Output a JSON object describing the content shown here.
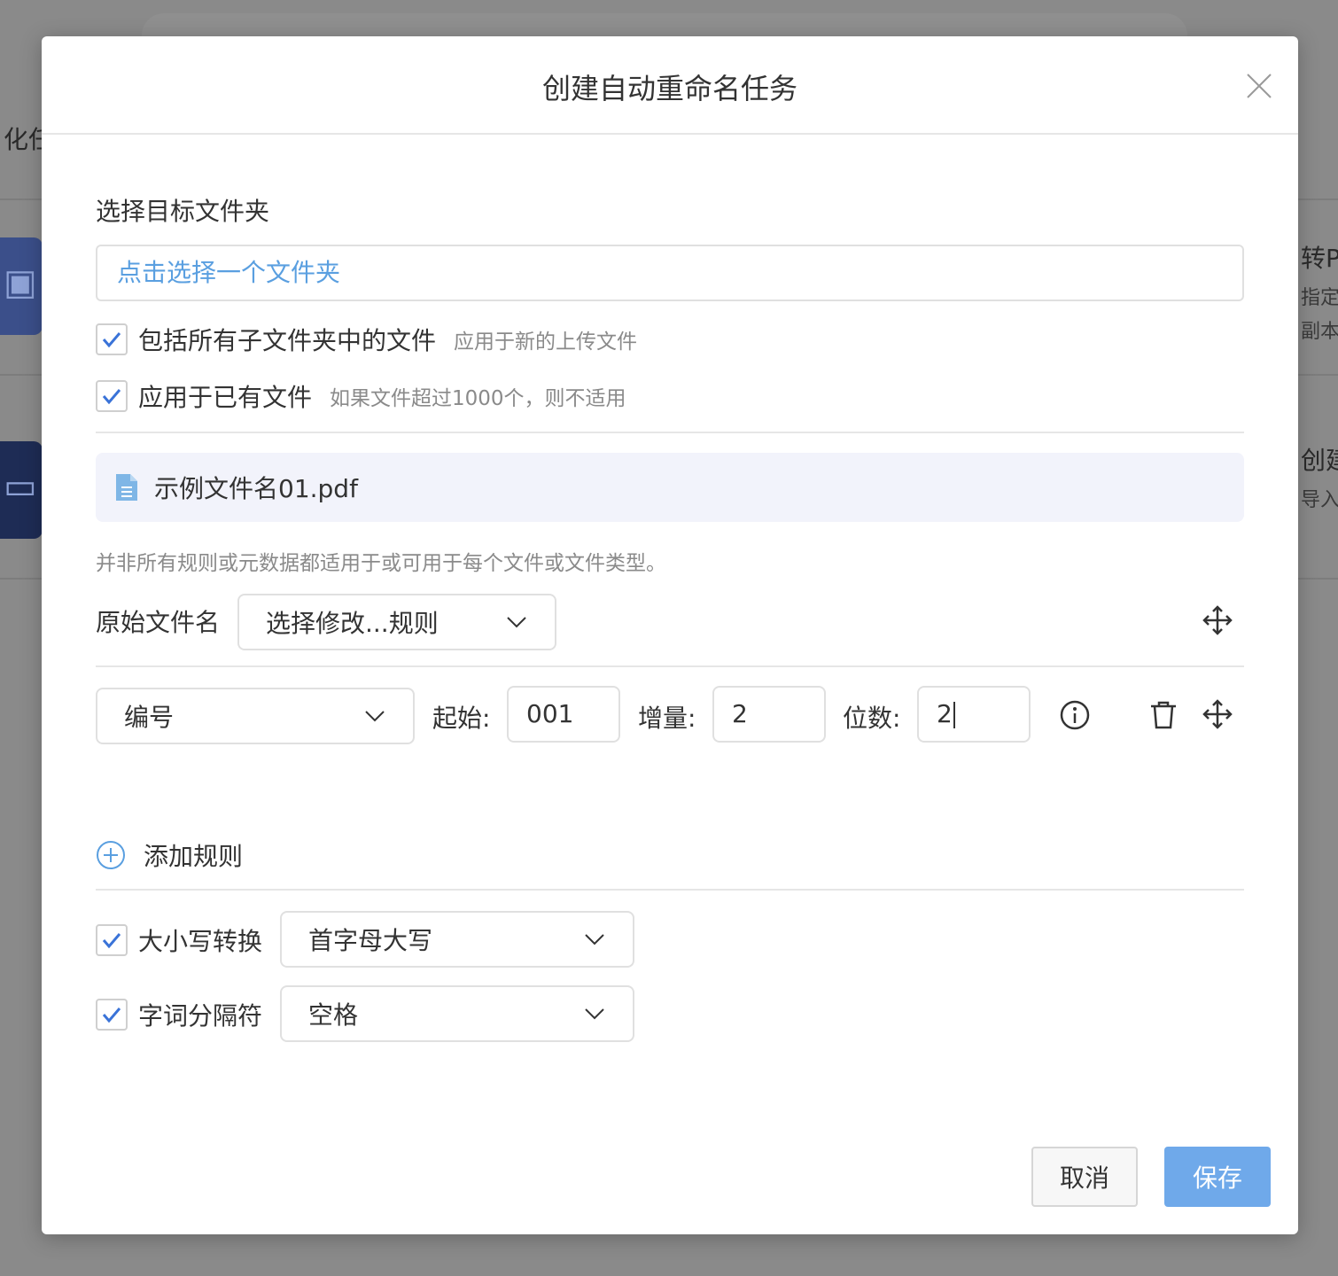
{
  "background": {
    "fragments": [
      "化任",
      "转PD",
      "指定文",
      "副本。",
      "创建",
      "导入e"
    ]
  },
  "modal": {
    "title": "创建自动重命名任务",
    "close_icon": "close-icon"
  },
  "target_folder": {
    "label": "选择目标文件夹",
    "placeholder": "点击选择一个文件夹"
  },
  "options": [
    {
      "label": "包括所有子文件夹中的文件",
      "hint": "应用于新的上传文件",
      "checked": true
    },
    {
      "label": "应用于已有文件",
      "hint": "如果文件超过1000个，则不适用",
      "checked": true
    }
  ],
  "preview": {
    "icon": "document-icon",
    "filename": "示例文件名01.pdf"
  },
  "note": "并非所有规则或元数据都适用于或可用于每个文件或文件类型。",
  "rule_original": {
    "label": "原始文件名",
    "select_value": "选择修改...规则"
  },
  "rule_number": {
    "type_value": "编号",
    "start_label": "起始:",
    "start_value": "001",
    "increment_label": "增量:",
    "increment_value": "2",
    "digits_label": "位数:",
    "digits_value": "2"
  },
  "add_rule_label": "添加规则",
  "case_convert": {
    "label": "大小写转换",
    "value": "首字母大写",
    "checked": true
  },
  "word_separator": {
    "label": "字词分隔符",
    "value": "空格",
    "checked": true
  },
  "footer": {
    "cancel_label": "取消",
    "save_label": "保存"
  },
  "colors": {
    "accent": "#5a9fe0",
    "save_button": "#6fa9ea",
    "preview_bg": "#f2f3fb"
  }
}
